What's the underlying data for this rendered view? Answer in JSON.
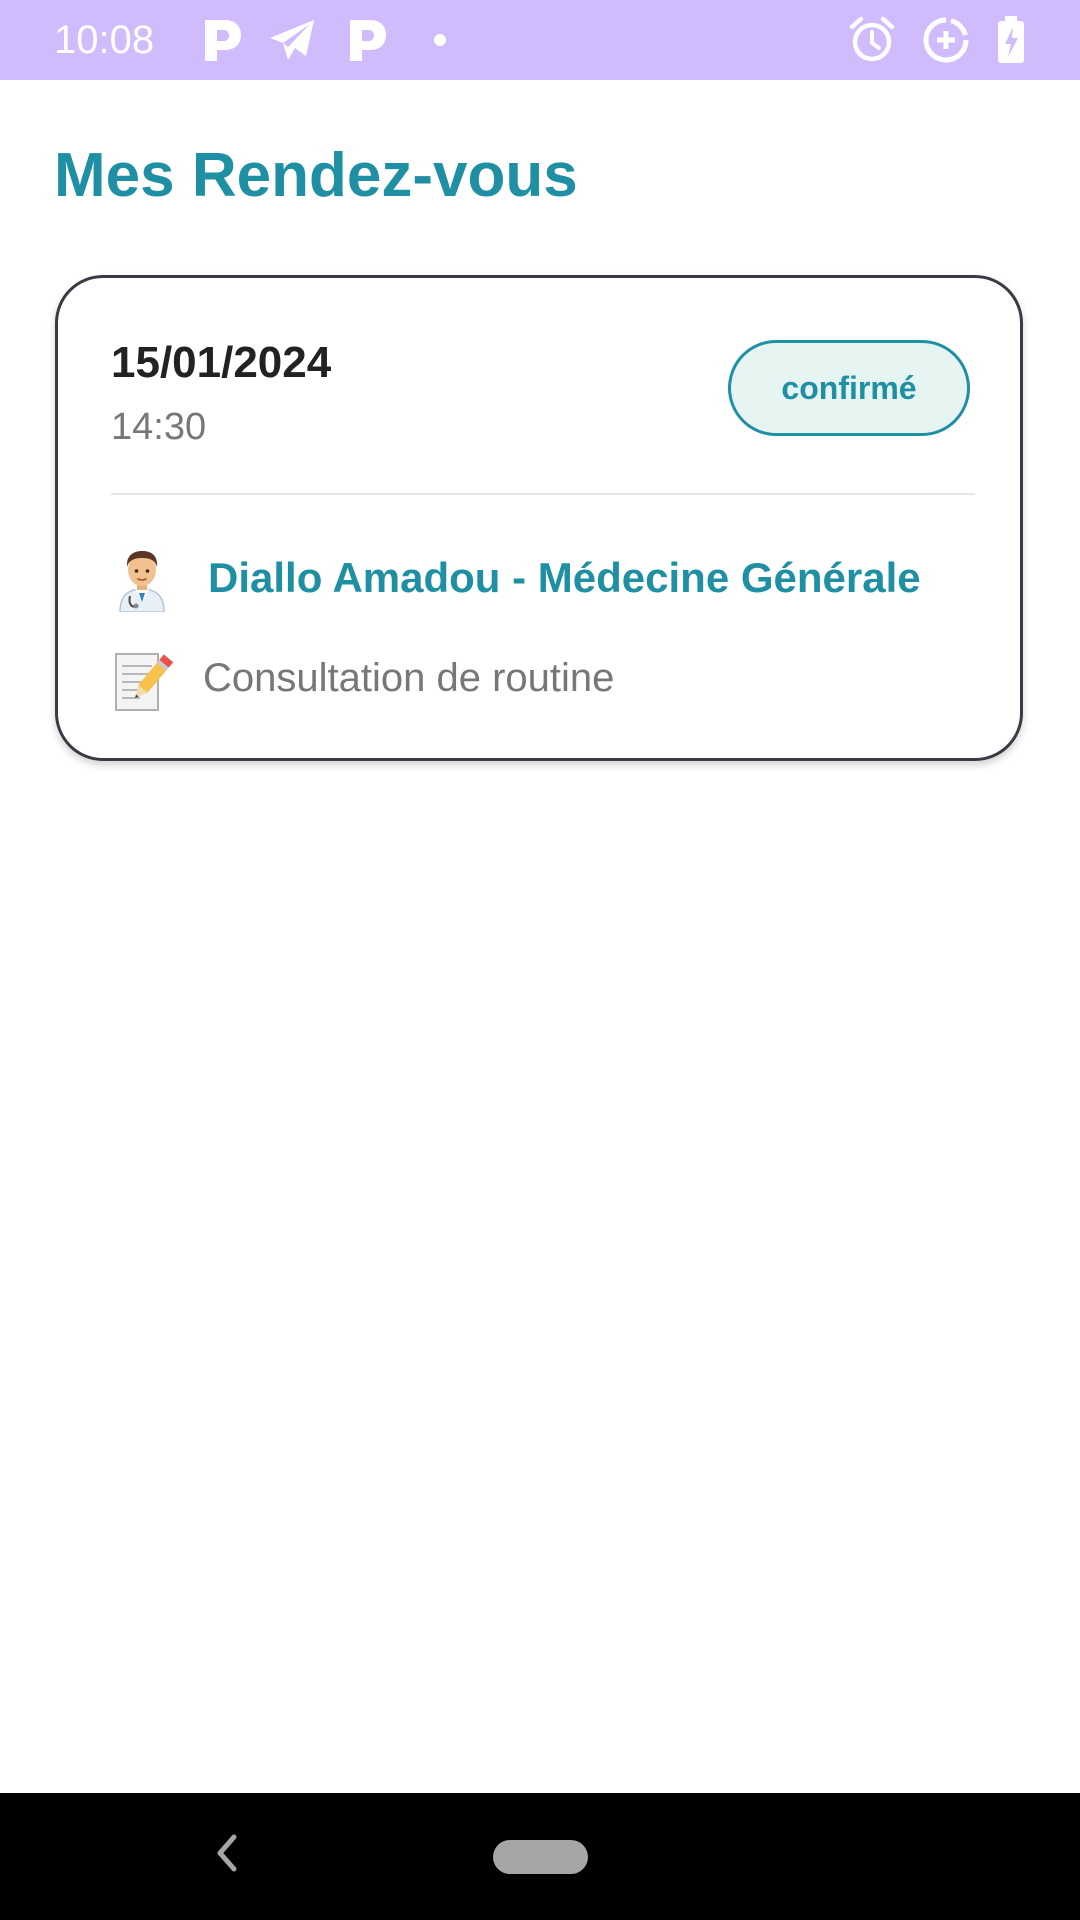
{
  "status_bar": {
    "time": "10:08",
    "left_icons": [
      "parking-icon",
      "telegram-icon",
      "parking-icon",
      "dot-icon"
    ],
    "right_icons": [
      "alarm-icon",
      "data-saver-icon",
      "battery-charging-icon"
    ],
    "background": "#d0bcfd"
  },
  "page": {
    "title": "Mes Rendez-vous",
    "accent_color": "#1f8fa3"
  },
  "appointments": [
    {
      "date": "15/01/2024",
      "time": "14:30",
      "status": "confirmé",
      "doctor_icon": "doctor-emoji-icon",
      "doctor": "Diallo Amadou - Médecine Générale",
      "note_icon": "memo-emoji-icon",
      "note": "Consultation de routine"
    }
  ],
  "nav_bar": {
    "icons": [
      "back-icon",
      "home-pill-icon"
    ]
  }
}
